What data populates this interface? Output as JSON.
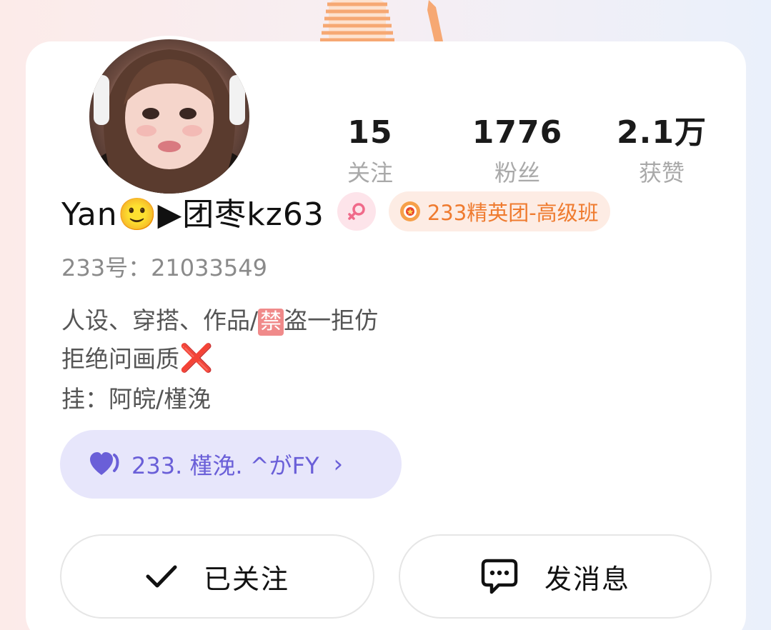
{
  "stats": [
    {
      "value": "15",
      "label": "关注"
    },
    {
      "value": "1776",
      "label": "粉丝"
    },
    {
      "value": "2.1万",
      "label": "获赞"
    }
  ],
  "profile": {
    "username": "Yan🙂▶团枣kz63",
    "gender_icon": "female-symbol-icon",
    "group_badge": "233精英团-高级班",
    "uid": "233号：21033549"
  },
  "bio": {
    "line1_prefix": "人设、穿搭、作品/",
    "line1_ban": "禁",
    "line1_suffix": "盗一拒仿",
    "line2_text": "拒绝问画质",
    "line2_icon": "❌",
    "line3": "挂：阿皖/槿浼"
  },
  "group_link": {
    "text": "233. 槿浼. ^がFY",
    "chevron": "›"
  },
  "buttons": {
    "follow": "已关注",
    "message": "发消息"
  },
  "colors": {
    "accent_purple": "#6a5fd8",
    "badge_orange": "#ef7b2f",
    "gender_pink": "#f06a8a"
  }
}
